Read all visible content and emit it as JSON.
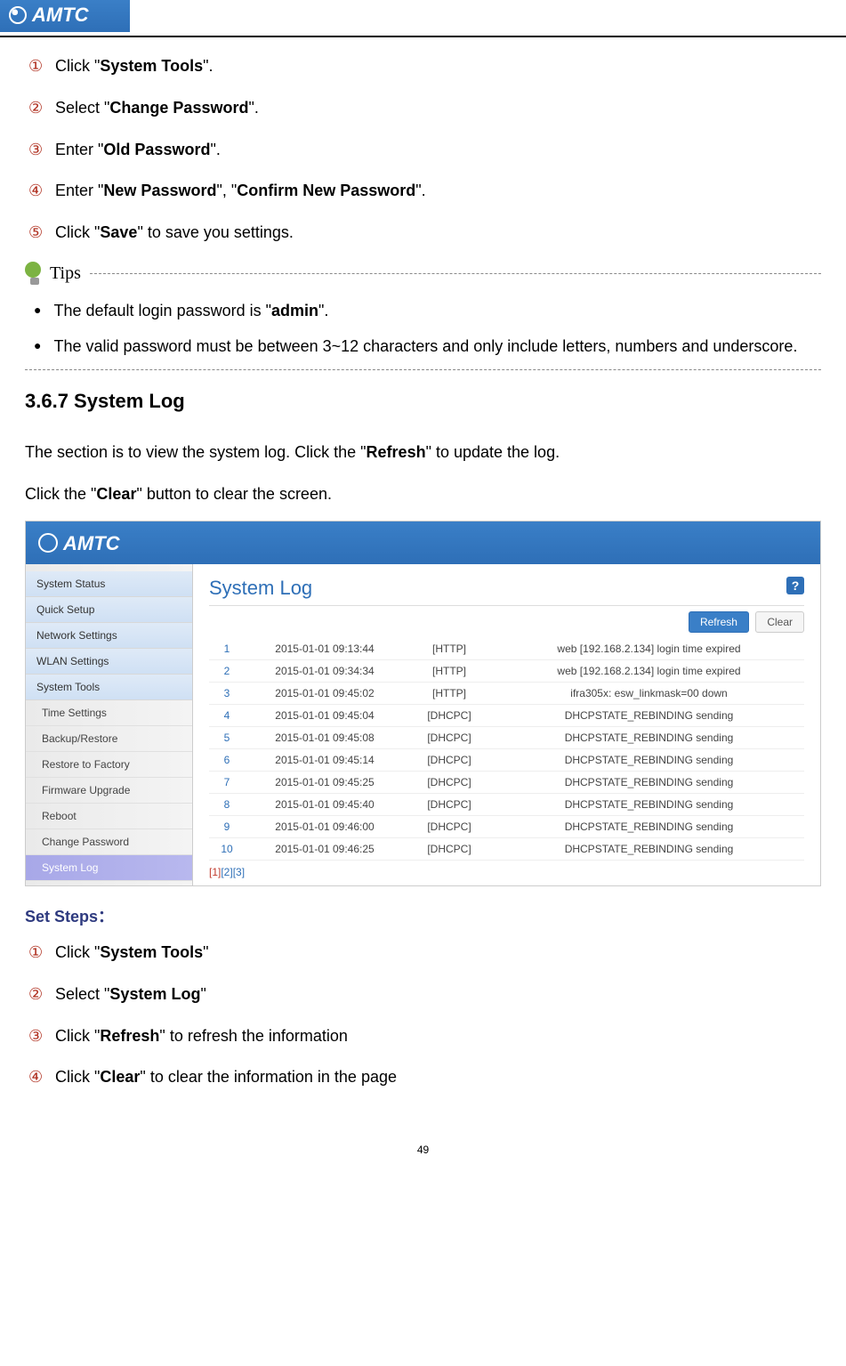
{
  "logo_text": "AMTC",
  "steps_top": [
    {
      "num": "①",
      "pre": "Click \"",
      "bold": "System Tools",
      "post": "\"."
    },
    {
      "num": "②",
      "pre": "Select \"",
      "bold": "Change Password",
      "post": "\"."
    },
    {
      "num": "③",
      "pre": "Enter \"",
      "bold": "Old Password",
      "post": "\"."
    },
    {
      "num": "④",
      "pre": "Enter \"",
      "bold": "New Password",
      "post": "\", \"",
      "bold2": "Confirm New Password",
      "post2": "\"."
    },
    {
      "num": "⑤",
      "pre": "Click \"",
      "bold": "Save",
      "post": "\" to save you settings."
    }
  ],
  "tips_label": "Tips",
  "tips_bullets": [
    {
      "pre": "The default login password is \"",
      "bold": "admin",
      "post": "\"."
    },
    {
      "pre": "The valid password must be between 3~12 characters and only include letters, numbers and underscore.",
      "bold": "",
      "post": ""
    }
  ],
  "section_title": "3.6.7 System Log",
  "intro_line1_pre": "The section is to view the system log. Click the \"",
  "intro_line1_bold": "Refresh",
  "intro_line1_post": "\" to update the log.",
  "intro_line2_pre": "Click the \"",
  "intro_line2_bold": "Clear",
  "intro_line2_post": "\" button to clear the screen.",
  "ui": {
    "brand": "AMTC",
    "sidebar_main": [
      "System Status",
      "Quick Setup",
      "Network Settings",
      "WLAN Settings",
      "System Tools"
    ],
    "sidebar_sub": [
      "Time Settings",
      "Backup/Restore",
      "Restore to Factory",
      "Firmware Upgrade",
      "Reboot",
      "Change Password",
      "System Log"
    ],
    "active_sub": "System Log",
    "title": "System Log",
    "help": "?",
    "buttons": {
      "refresh": "Refresh",
      "clear": "Clear"
    },
    "log": [
      {
        "n": "1",
        "t": "2015-01-01 09:13:44",
        "src": "[HTTP]",
        "msg": "web [192.168.2.134] login time expired"
      },
      {
        "n": "2",
        "t": "2015-01-01 09:34:34",
        "src": "[HTTP]",
        "msg": "web [192.168.2.134] login time expired"
      },
      {
        "n": "3",
        "t": "2015-01-01 09:45:02",
        "src": "[HTTP]",
        "msg": "ifra305x: esw_linkmask=00 down"
      },
      {
        "n": "4",
        "t": "2015-01-01 09:45:04",
        "src": "[DHCPC]",
        "msg": "DHCPSTATE_REBINDING sending"
      },
      {
        "n": "5",
        "t": "2015-01-01 09:45:08",
        "src": "[DHCPC]",
        "msg": "DHCPSTATE_REBINDING sending"
      },
      {
        "n": "6",
        "t": "2015-01-01 09:45:14",
        "src": "[DHCPC]",
        "msg": "DHCPSTATE_REBINDING sending"
      },
      {
        "n": "7",
        "t": "2015-01-01 09:45:25",
        "src": "[DHCPC]",
        "msg": "DHCPSTATE_REBINDING sending"
      },
      {
        "n": "8",
        "t": "2015-01-01 09:45:40",
        "src": "[DHCPC]",
        "msg": "DHCPSTATE_REBINDING sending"
      },
      {
        "n": "9",
        "t": "2015-01-01 09:46:00",
        "src": "[DHCPC]",
        "msg": "DHCPSTATE_REBINDING sending"
      },
      {
        "n": "10",
        "t": "2015-01-01 09:46:25",
        "src": "[DHCPC]",
        "msg": "DHCPSTATE_REBINDING sending"
      }
    ],
    "pages": [
      "[1]",
      "[2]",
      "[3]"
    ]
  },
  "set_steps_title": "Set Steps：",
  "steps_bottom": [
    {
      "num": "①",
      "pre": "Click \"",
      "bold": "System Tools",
      "post": "\""
    },
    {
      "num": "②",
      "pre": "Select \"",
      "bold": "System Log",
      "post": "\""
    },
    {
      "num": "③",
      "pre": "Click \"",
      "bold": "Refresh",
      "post": "\" to refresh the information"
    },
    {
      "num": "④",
      "pre": "Click \"",
      "bold": "Clear",
      "post": "\" to clear the information in the page"
    }
  ],
  "page_number": "49"
}
